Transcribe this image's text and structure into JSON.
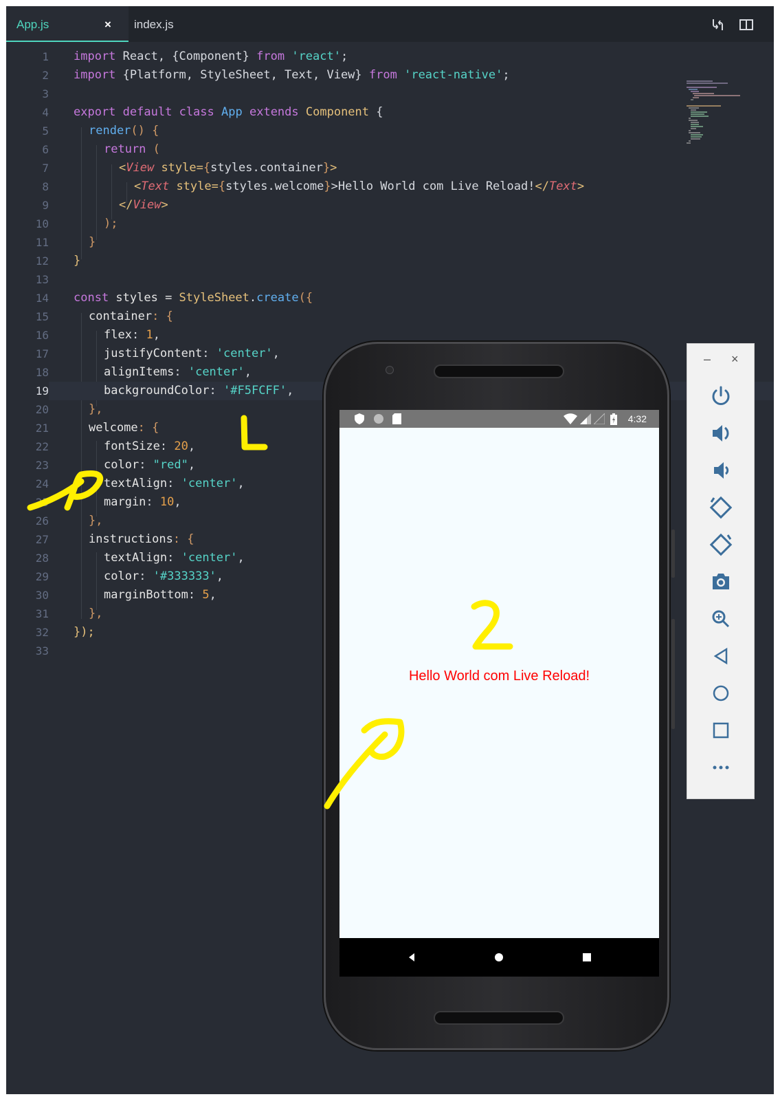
{
  "tabs": [
    {
      "label": "App.js",
      "active": true
    },
    {
      "label": "index.js",
      "active": false
    }
  ],
  "tab_close_glyph": "×",
  "line_numbers": [
    "1",
    "2",
    "3",
    "4",
    "5",
    "6",
    "7",
    "8",
    "9",
    "10",
    "11",
    "12",
    "13",
    "14",
    "15",
    "16",
    "17",
    "18",
    "19",
    "20",
    "21",
    "22",
    "23",
    "24",
    "25",
    "26",
    "27",
    "28",
    "29",
    "30",
    "31",
    "32",
    "33"
  ],
  "code": {
    "l1": [
      "import",
      " React, {Component} ",
      "from",
      " ",
      "'react'",
      ";"
    ],
    "l2": [
      "import",
      " {Platform, StyleSheet, Text, View} ",
      "from",
      " ",
      "'react-native'",
      ";"
    ],
    "l4": [
      "export",
      " ",
      "default",
      " ",
      "class",
      " ",
      "App",
      " ",
      "extends",
      " ",
      "Component",
      " {"
    ],
    "l5": [
      "render",
      "() {"
    ],
    "l6": [
      "return",
      " ("
    ],
    "l7": [
      "<",
      "View",
      " style=",
      "{",
      "styles.container",
      "}",
      ">"
    ],
    "l8": [
      "<",
      "Text",
      " style=",
      "{",
      "styles.welcome",
      "}",
      ">Hello World com Live Reload!",
      "</",
      "Text",
      ">"
    ],
    "l9": [
      "</",
      "View",
      ">"
    ],
    "l10": [
      ");"
    ],
    "l11": [
      "}"
    ],
    "l12": [
      "}"
    ],
    "l14": [
      "const",
      " styles = ",
      "StyleSheet",
      ".",
      "create",
      "({"
    ],
    "l15": [
      "container",
      ": {"
    ],
    "l16": [
      "flex",
      ": ",
      "1",
      ","
    ],
    "l17": [
      "justifyContent",
      ": ",
      "'center'",
      ","
    ],
    "l18": [
      "alignItems",
      ": ",
      "'center'",
      ","
    ],
    "l19": [
      "backgroundColor",
      ": ",
      "'#F5FCFF'",
      ","
    ],
    "l20": [
      "},"
    ],
    "l21": [
      "welcome",
      ": {"
    ],
    "l22": [
      "fontSize",
      ": ",
      "20",
      ","
    ],
    "l23": [
      "color",
      ": ",
      "\"red\"",
      ","
    ],
    "l24": [
      "textAlign",
      ": ",
      "'center'",
      ","
    ],
    "l25": [
      "margin",
      ": ",
      "10",
      ","
    ],
    "l26": [
      "},"
    ],
    "l27": [
      "instructions",
      ": {"
    ],
    "l28": [
      "textAlign",
      ": ",
      "'center'",
      ","
    ],
    "l29": [
      "color",
      ": ",
      "'#333333'",
      ","
    ],
    "l30": [
      "marginBottom",
      ": ",
      "5",
      ","
    ],
    "l31": [
      "},"
    ],
    "l32": [
      "});"
    ]
  },
  "phone": {
    "status_time": "4:32",
    "app_text": "Hello World com Live Reload!",
    "app_bg": "#F5FCFF",
    "app_text_color": "#ff0000"
  },
  "emulator": {
    "minimize": "–",
    "close": "×",
    "icons": [
      "power-icon",
      "volume-up-icon",
      "volume-down-icon",
      "rotate-left-icon",
      "rotate-right-icon",
      "camera-icon",
      "zoom-icon",
      "back-icon",
      "home-icon",
      "overview-icon",
      "more-icon"
    ]
  },
  "annotations": [
    "1",
    "2"
  ],
  "colors": {
    "editor_bg": "#282c34",
    "accent": "#4fd6be",
    "annotation": "#ffef00"
  }
}
